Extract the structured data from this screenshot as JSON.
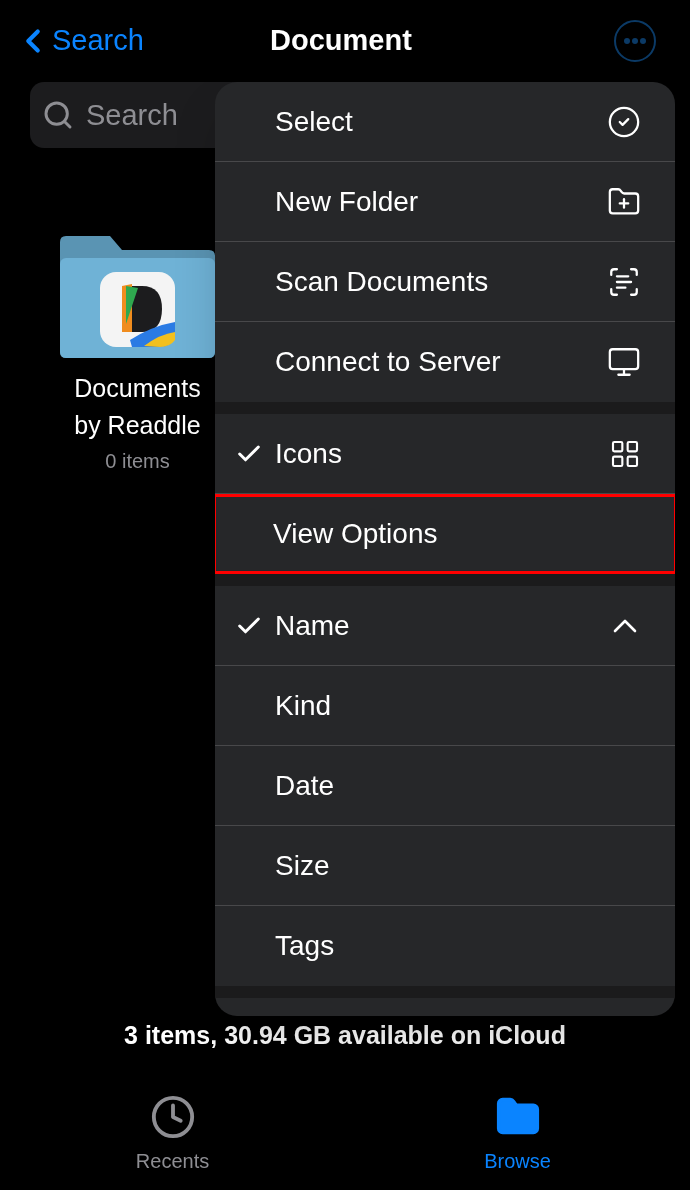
{
  "nav": {
    "back": "Search",
    "title": "Document"
  },
  "search": {
    "placeholder": "Search"
  },
  "folders": [
    {
      "name": "Documents by Readdle",
      "count": "0 items"
    }
  ],
  "menu": {
    "groups": [
      {
        "items": [
          {
            "kind": "action",
            "label": "Select"
          },
          {
            "kind": "action",
            "label": "New Folder"
          },
          {
            "kind": "action",
            "label": "Scan Documents"
          },
          {
            "kind": "action",
            "label": "Connect to Server"
          }
        ]
      },
      {
        "items": [
          {
            "kind": "option",
            "label": "Icons",
            "checked": true,
            "highlighted": false
          },
          {
            "kind": "option",
            "label": "View Options",
            "checked": false,
            "highlighted": true
          }
        ]
      },
      {
        "items": [
          {
            "kind": "sort",
            "label": "Name",
            "checked": true
          },
          {
            "kind": "sort",
            "label": "Kind",
            "checked": false
          },
          {
            "kind": "sort",
            "label": "Date",
            "checked": false
          },
          {
            "kind": "sort",
            "label": "Size",
            "checked": false
          },
          {
            "kind": "sort",
            "label": "Tags",
            "checked": false
          }
        ]
      }
    ]
  },
  "status": "3 items, 30.94 GB available on iCloud",
  "tabs": [
    {
      "label": "Recents",
      "selected": false
    },
    {
      "label": "Browse",
      "selected": true
    }
  ]
}
